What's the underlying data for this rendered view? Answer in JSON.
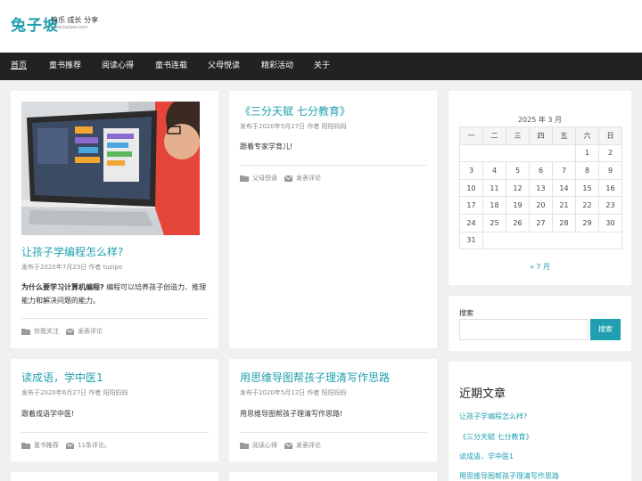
{
  "site": {
    "logo_text": "兔子坡",
    "tagline": "快乐 成长 分享",
    "url_text": "www.tuzipo.com"
  },
  "nav": {
    "items": [
      "首页",
      "童书推荐",
      "阅读心得",
      "童书连载",
      "父母悦读",
      "精彩活动",
      "关于"
    ]
  },
  "posts": [
    {
      "title": "让孩子学编程怎么样?",
      "meta": "发布于2020年7月23日 作者 tuzipo",
      "excerpt_bold": "为什么要学习计算机编程?",
      "excerpt_rest": " 编程可以培养孩子创造力、推理能力和解决问题的能力。",
      "category": "你我关注",
      "comments": "发表评论"
    },
    {
      "title": "《三分天赋 七分教育》",
      "meta": "发布于2020年5月27日 作者 阳阳妈妈",
      "excerpt": "跟着专家学育儿!",
      "category": "父母悦读",
      "comments": "发表评论"
    },
    {
      "title": "读成语，学中医1",
      "meta": "发布于2020年6月27日 作者 阳阳妈妈",
      "excerpt": "跟着成语学中医!",
      "category": "童书推荐",
      "comments": "11条评论。"
    },
    {
      "title": "用思维导图帮孩子理清写作思路",
      "meta": "发布于2020年5月12日 作者 阳阳妈妈",
      "excerpt": "用思维导图帮孩子理清写作思路!",
      "category": "阅读心得",
      "comments": "发表评论"
    }
  ],
  "calendar": {
    "caption": "2025 年 3 月",
    "weekdays": [
      "一",
      "二",
      "三",
      "四",
      "五",
      "六",
      "日"
    ],
    "weeks": [
      [
        "",
        "",
        "",
        "",
        "",
        "1",
        "2"
      ],
      [
        "3",
        "4",
        "5",
        "6",
        "7",
        "8",
        "9"
      ],
      [
        "10",
        "11",
        "12",
        "13",
        "14",
        "15",
        "16"
      ],
      [
        "17",
        "18",
        "19",
        "20",
        "21",
        "22",
        "23"
      ],
      [
        "24",
        "25",
        "26",
        "27",
        "28",
        "29",
        "30"
      ],
      [
        "31"
      ]
    ],
    "prev_link": "« 7 月"
  },
  "search": {
    "label": "搜索",
    "placeholder": "",
    "button": "搜索"
  },
  "recent": {
    "heading": "近期文章",
    "links": [
      "让孩子学编程怎么样?",
      "《三分天赋 七分教育》",
      "读成语，学中医1",
      "用思维导图帮孩子理清写作思路"
    ]
  },
  "colors": {
    "accent": "#1f9fb0",
    "nav_bg": "#222222",
    "page_bg": "#f0f0f0"
  }
}
